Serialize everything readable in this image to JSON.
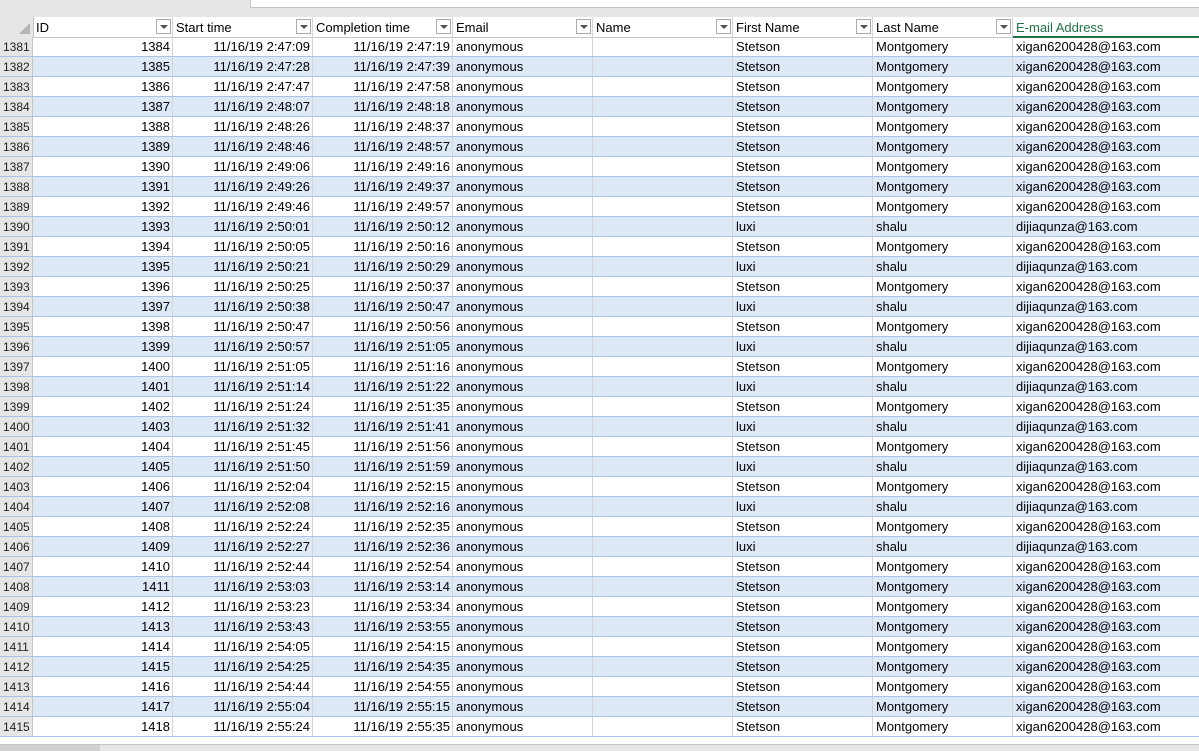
{
  "columns": [
    "ID",
    "Start time",
    "Completion time",
    "Email",
    "Name",
    "First Name",
    "Last Name",
    "E-mail Address"
  ],
  "active_column_index": 7,
  "rows": [
    {
      "rownum": "1381",
      "id": "1384",
      "start": "11/16/19 2:47:09",
      "end": "11/16/19 2:47:19",
      "email": "anonymous",
      "name": "",
      "first": "Stetson",
      "last": "Montgomery",
      "address": "xigan6200428@163.com"
    },
    {
      "rownum": "1382",
      "id": "1385",
      "start": "11/16/19 2:47:28",
      "end": "11/16/19 2:47:39",
      "email": "anonymous",
      "name": "",
      "first": "Stetson",
      "last": "Montgomery",
      "address": "xigan6200428@163.com"
    },
    {
      "rownum": "1383",
      "id": "1386",
      "start": "11/16/19 2:47:47",
      "end": "11/16/19 2:47:58",
      "email": "anonymous",
      "name": "",
      "first": "Stetson",
      "last": "Montgomery",
      "address": "xigan6200428@163.com"
    },
    {
      "rownum": "1384",
      "id": "1387",
      "start": "11/16/19 2:48:07",
      "end": "11/16/19 2:48:18",
      "email": "anonymous",
      "name": "",
      "first": "Stetson",
      "last": "Montgomery",
      "address": "xigan6200428@163.com"
    },
    {
      "rownum": "1385",
      "id": "1388",
      "start": "11/16/19 2:48:26",
      "end": "11/16/19 2:48:37",
      "email": "anonymous",
      "name": "",
      "first": "Stetson",
      "last": "Montgomery",
      "address": "xigan6200428@163.com"
    },
    {
      "rownum": "1386",
      "id": "1389",
      "start": "11/16/19 2:48:46",
      "end": "11/16/19 2:48:57",
      "email": "anonymous",
      "name": "",
      "first": "Stetson",
      "last": "Montgomery",
      "address": "xigan6200428@163.com"
    },
    {
      "rownum": "1387",
      "id": "1390",
      "start": "11/16/19 2:49:06",
      "end": "11/16/19 2:49:16",
      "email": "anonymous",
      "name": "",
      "first": "Stetson",
      "last": "Montgomery",
      "address": "xigan6200428@163.com"
    },
    {
      "rownum": "1388",
      "id": "1391",
      "start": "11/16/19 2:49:26",
      "end": "11/16/19 2:49:37",
      "email": "anonymous",
      "name": "",
      "first": "Stetson",
      "last": "Montgomery",
      "address": "xigan6200428@163.com"
    },
    {
      "rownum": "1389",
      "id": "1392",
      "start": "11/16/19 2:49:46",
      "end": "11/16/19 2:49:57",
      "email": "anonymous",
      "name": "",
      "first": "Stetson",
      "last": "Montgomery",
      "address": "xigan6200428@163.com"
    },
    {
      "rownum": "1390",
      "id": "1393",
      "start": "11/16/19 2:50:01",
      "end": "11/16/19 2:50:12",
      "email": "anonymous",
      "name": "",
      "first": "luxi",
      "last": "shalu",
      "address": "dijiaqunza@163.com"
    },
    {
      "rownum": "1391",
      "id": "1394",
      "start": "11/16/19 2:50:05",
      "end": "11/16/19 2:50:16",
      "email": "anonymous",
      "name": "",
      "first": "Stetson",
      "last": "Montgomery",
      "address": "xigan6200428@163.com"
    },
    {
      "rownum": "1392",
      "id": "1395",
      "start": "11/16/19 2:50:21",
      "end": "11/16/19 2:50:29",
      "email": "anonymous",
      "name": "",
      "first": "luxi",
      "last": "shalu",
      "address": "dijiaqunza@163.com"
    },
    {
      "rownum": "1393",
      "id": "1396",
      "start": "11/16/19 2:50:25",
      "end": "11/16/19 2:50:37",
      "email": "anonymous",
      "name": "",
      "first": "Stetson",
      "last": "Montgomery",
      "address": "xigan6200428@163.com"
    },
    {
      "rownum": "1394",
      "id": "1397",
      "start": "11/16/19 2:50:38",
      "end": "11/16/19 2:50:47",
      "email": "anonymous",
      "name": "",
      "first": "luxi",
      "last": "shalu",
      "address": "dijiaqunza@163.com"
    },
    {
      "rownum": "1395",
      "id": "1398",
      "start": "11/16/19 2:50:47",
      "end": "11/16/19 2:50:56",
      "email": "anonymous",
      "name": "",
      "first": "Stetson",
      "last": "Montgomery",
      "address": "xigan6200428@163.com"
    },
    {
      "rownum": "1396",
      "id": "1399",
      "start": "11/16/19 2:50:57",
      "end": "11/16/19 2:51:05",
      "email": "anonymous",
      "name": "",
      "first": "luxi",
      "last": "shalu",
      "address": "dijiaqunza@163.com"
    },
    {
      "rownum": "1397",
      "id": "1400",
      "start": "11/16/19 2:51:05",
      "end": "11/16/19 2:51:16",
      "email": "anonymous",
      "name": "",
      "first": "Stetson",
      "last": "Montgomery",
      "address": "xigan6200428@163.com"
    },
    {
      "rownum": "1398",
      "id": "1401",
      "start": "11/16/19 2:51:14",
      "end": "11/16/19 2:51:22",
      "email": "anonymous",
      "name": "",
      "first": "luxi",
      "last": "shalu",
      "address": "dijiaqunza@163.com"
    },
    {
      "rownum": "1399",
      "id": "1402",
      "start": "11/16/19 2:51:24",
      "end": "11/16/19 2:51:35",
      "email": "anonymous",
      "name": "",
      "first": "Stetson",
      "last": "Montgomery",
      "address": "xigan6200428@163.com"
    },
    {
      "rownum": "1400",
      "id": "1403",
      "start": "11/16/19 2:51:32",
      "end": "11/16/19 2:51:41",
      "email": "anonymous",
      "name": "",
      "first": "luxi",
      "last": "shalu",
      "address": "dijiaqunza@163.com"
    },
    {
      "rownum": "1401",
      "id": "1404",
      "start": "11/16/19 2:51:45",
      "end": "11/16/19 2:51:56",
      "email": "anonymous",
      "name": "",
      "first": "Stetson",
      "last": "Montgomery",
      "address": "xigan6200428@163.com"
    },
    {
      "rownum": "1402",
      "id": "1405",
      "start": "11/16/19 2:51:50",
      "end": "11/16/19 2:51:59",
      "email": "anonymous",
      "name": "",
      "first": "luxi",
      "last": "shalu",
      "address": "dijiaqunza@163.com"
    },
    {
      "rownum": "1403",
      "id": "1406",
      "start": "11/16/19 2:52:04",
      "end": "11/16/19 2:52:15",
      "email": "anonymous",
      "name": "",
      "first": "Stetson",
      "last": "Montgomery",
      "address": "xigan6200428@163.com"
    },
    {
      "rownum": "1404",
      "id": "1407",
      "start": "11/16/19 2:52:08",
      "end": "11/16/19 2:52:16",
      "email": "anonymous",
      "name": "",
      "first": "luxi",
      "last": "shalu",
      "address": "dijiaqunza@163.com"
    },
    {
      "rownum": "1405",
      "id": "1408",
      "start": "11/16/19 2:52:24",
      "end": "11/16/19 2:52:35",
      "email": "anonymous",
      "name": "",
      "first": "Stetson",
      "last": "Montgomery",
      "address": "xigan6200428@163.com"
    },
    {
      "rownum": "1406",
      "id": "1409",
      "start": "11/16/19 2:52:27",
      "end": "11/16/19 2:52:36",
      "email": "anonymous",
      "name": "",
      "first": "luxi",
      "last": "shalu",
      "address": "dijiaqunza@163.com"
    },
    {
      "rownum": "1407",
      "id": "1410",
      "start": "11/16/19 2:52:44",
      "end": "11/16/19 2:52:54",
      "email": "anonymous",
      "name": "",
      "first": "Stetson",
      "last": "Montgomery",
      "address": "xigan6200428@163.com"
    },
    {
      "rownum": "1408",
      "id": "1411",
      "start": "11/16/19 2:53:03",
      "end": "11/16/19 2:53:14",
      "email": "anonymous",
      "name": "",
      "first": "Stetson",
      "last": "Montgomery",
      "address": "xigan6200428@163.com"
    },
    {
      "rownum": "1409",
      "id": "1412",
      "start": "11/16/19 2:53:23",
      "end": "11/16/19 2:53:34",
      "email": "anonymous",
      "name": "",
      "first": "Stetson",
      "last": "Montgomery",
      "address": "xigan6200428@163.com"
    },
    {
      "rownum": "1410",
      "id": "1413",
      "start": "11/16/19 2:53:43",
      "end": "11/16/19 2:53:55",
      "email": "anonymous",
      "name": "",
      "first": "Stetson",
      "last": "Montgomery",
      "address": "xigan6200428@163.com"
    },
    {
      "rownum": "1411",
      "id": "1414",
      "start": "11/16/19 2:54:05",
      "end": "11/16/19 2:54:15",
      "email": "anonymous",
      "name": "",
      "first": "Stetson",
      "last": "Montgomery",
      "address": "xigan6200428@163.com"
    },
    {
      "rownum": "1412",
      "id": "1415",
      "start": "11/16/19 2:54:25",
      "end": "11/16/19 2:54:35",
      "email": "anonymous",
      "name": "",
      "first": "Stetson",
      "last": "Montgomery",
      "address": "xigan6200428@163.com"
    },
    {
      "rownum": "1413",
      "id": "1416",
      "start": "11/16/19 2:54:44",
      "end": "11/16/19 2:54:55",
      "email": "anonymous",
      "name": "",
      "first": "Stetson",
      "last": "Montgomery",
      "address": "xigan6200428@163.com"
    },
    {
      "rownum": "1414",
      "id": "1417",
      "start": "11/16/19 2:55:04",
      "end": "11/16/19 2:55:15",
      "email": "anonymous",
      "name": "",
      "first": "Stetson",
      "last": "Montgomery",
      "address": "xigan6200428@163.com"
    },
    {
      "rownum": "1415",
      "id": "1418",
      "start": "11/16/19 2:55:24",
      "end": "11/16/19 2:55:35",
      "email": "anonymous",
      "name": "",
      "first": "Stetson",
      "last": "Montgomery",
      "address": "xigan6200428@163.com"
    }
  ],
  "colors": {
    "band": "#dde9f6",
    "row_border": "#a9c4e8",
    "header_gray": "#e6e6e6",
    "accent_green": "#217346"
  }
}
